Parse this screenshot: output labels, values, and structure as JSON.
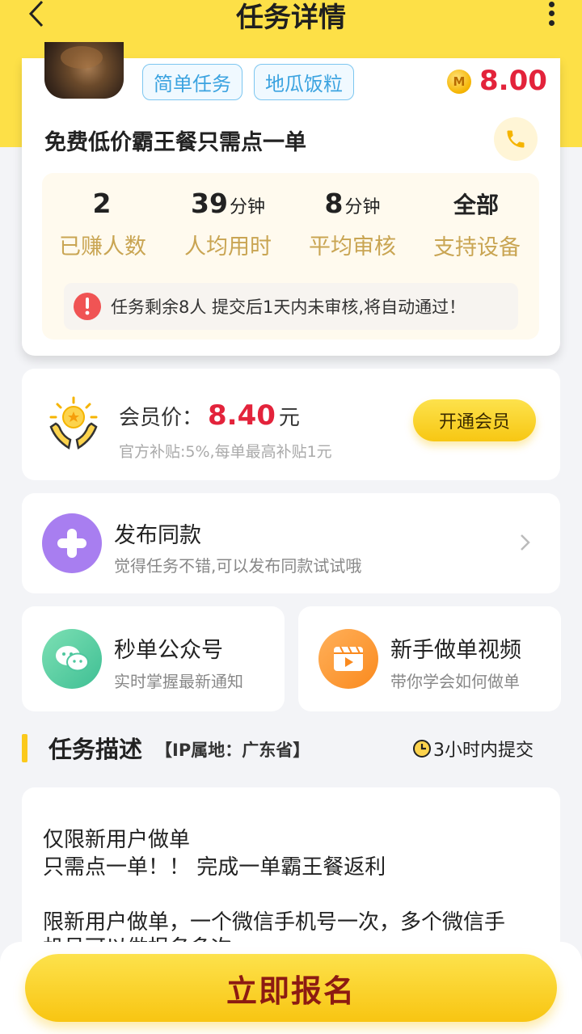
{
  "header": {
    "title": "任务详情",
    "back_icon": "chevron-left-icon",
    "more_icon": "more-vertical-icon"
  },
  "task": {
    "tags": [
      "简单任务",
      "地瓜饭粒"
    ],
    "coin_symbol": "M",
    "price": "8.00",
    "name": "免费低价霸王餐只需点一单",
    "stats": [
      {
        "value": "2",
        "unit": "",
        "label": "已赚人数"
      },
      {
        "value": "39",
        "unit": "分钟",
        "label": "人均用时"
      },
      {
        "value": "8",
        "unit": "分钟",
        "label": "平均审核"
      },
      {
        "value": "全部",
        "unit": "",
        "label": "支持设备"
      }
    ],
    "notice": "任务剩余8人  提交后1天内未审核,将自动通过！"
  },
  "member": {
    "label": "会员价：",
    "price": "8.40",
    "unit": "元",
    "subsidy": "官方补贴:5%,每单最高补贴1元",
    "button": "开通会员"
  },
  "publish": {
    "title": "发布同款",
    "subtitle": "觉得任务不错,可以发布同款试试哦"
  },
  "wechat": {
    "title": "秒单公众号",
    "subtitle": "实时掌握最新通知"
  },
  "video": {
    "title": "新手做单视频",
    "subtitle": "带你学会如何做单"
  },
  "section": {
    "title": "任务描述",
    "ip": "【IP属地：广东省】",
    "deadline": "3小时内提交"
  },
  "description": {
    "lines": [
      "仅限新用户做单",
      "只需点一单！！ 完成一单霸王餐返利",
      "",
      "限新用户做单，一个微信手机号一次，多个微信手",
      "机号可以做报名多次"
    ]
  },
  "footer": {
    "signup_button": "立即报名"
  },
  "colors": {
    "brand_yellow": "#fde047",
    "price_red": "#e3233b",
    "stat_label": "#c9a553"
  }
}
